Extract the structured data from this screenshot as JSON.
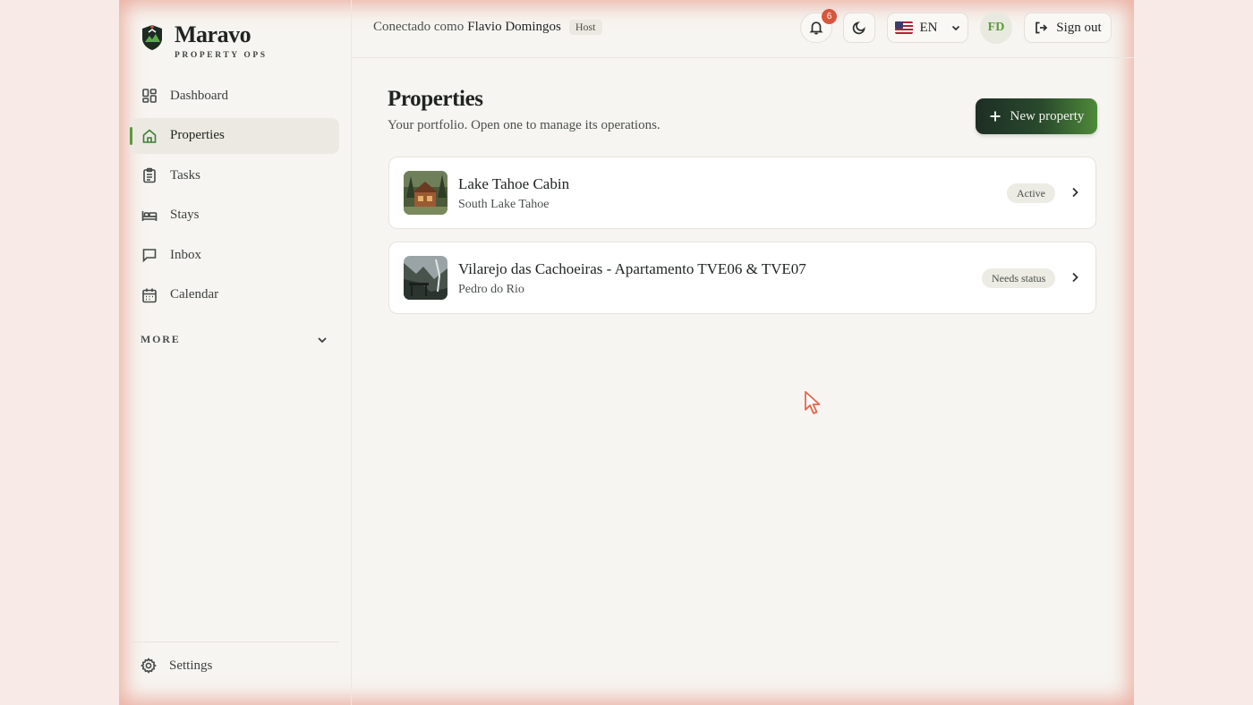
{
  "brand": {
    "name": "Maravo",
    "subtitle": "PROPERTY OPS"
  },
  "sidebar": {
    "items": [
      {
        "label": "Dashboard",
        "icon": "dashboard-icon"
      },
      {
        "label": "Properties",
        "icon": "home-icon",
        "active": true
      },
      {
        "label": "Tasks",
        "icon": "clipboard-icon"
      },
      {
        "label": "Stays",
        "icon": "bed-icon"
      },
      {
        "label": "Inbox",
        "icon": "message-icon"
      },
      {
        "label": "Calendar",
        "icon": "calendar-icon"
      }
    ],
    "more_label": "MORE",
    "settings_label": "Settings"
  },
  "header": {
    "connected_prefix": "Conectado como",
    "user_name": "Flavio Domingos",
    "role": "Host",
    "notifications_count": "6",
    "language": "EN",
    "avatar_initials": "FD",
    "signout_label": "Sign out"
  },
  "main": {
    "title": "Properties",
    "subtitle": "Your portfolio. Open one to manage its operations.",
    "new_property_label": "New property",
    "properties": [
      {
        "name": "Lake Tahoe Cabin",
        "location": "South Lake Tahoe",
        "status": "Active"
      },
      {
        "name": "Vilarejo das Cachoeiras - Apartamento TVE06 & TVE07",
        "location": "Pedro do Rio",
        "status": "Needs status"
      }
    ]
  },
  "colors": {
    "accent": "#5a9a3e",
    "primary_button": "#1d2e24",
    "badge": "#d5573c",
    "page_bg": "#f7f5f1"
  }
}
